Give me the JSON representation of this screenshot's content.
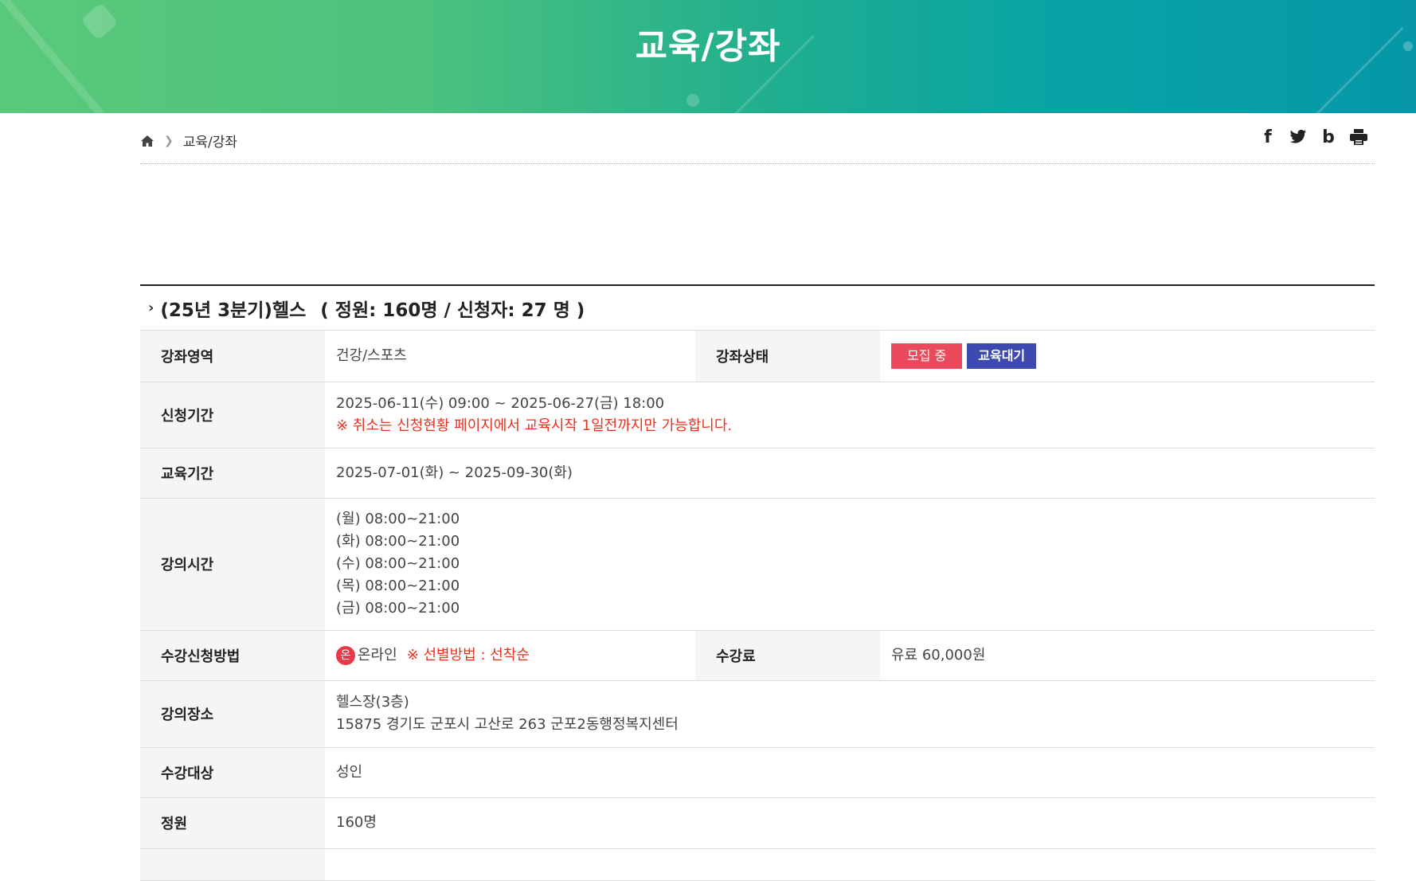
{
  "banner": {
    "title": "교육/강좌"
  },
  "breadcrumb": {
    "current": "교육/강좌"
  },
  "share": {
    "facebook": "f",
    "twitter": "🐦",
    "blog": "b",
    "print": "🖨"
  },
  "course": {
    "name": "(25년 3분기)헬스",
    "capacity_text": "( 정원: 160명 / 신청자: 27 명 )"
  },
  "rows": {
    "area_label": "강좌영역",
    "area_value": "건강/스포츠",
    "status_label": "강좌상태",
    "status_badge1": "모집 중",
    "status_badge2": "교육대기",
    "apply_label": "신청기간",
    "apply_value": "2025-06-11(수) 09:00 ~ 2025-06-27(금) 18:00",
    "apply_note": "※ 취소는 신청현황 페이지에서 교육시작 1일전까지만 가능합니다.",
    "edu_label": "교육기간",
    "edu_value": "2025-07-01(화) ~ 2025-09-30(화)",
    "time_label": "강의시간",
    "times": [
      "(월) 08:00~21:00",
      "(화) 08:00~21:00",
      "(수) 08:00~21:00",
      "(목) 08:00~21:00",
      "(금) 08:00~21:00"
    ],
    "method_label": "수강신청방법",
    "method_icon": "온",
    "method_value": "온라인",
    "method_note": "※ 선별방법 : 선착순",
    "fee_label": "수강료",
    "fee_value": "유료 60,000원",
    "place_label": "강의장소",
    "place_line1": "헬스장(3층)",
    "place_line2": "15875 경기도 군포시 고산로 263 군포2동행정복지센터",
    "target_label": "수강대상",
    "target_value": "성인",
    "cap_label": "정원",
    "cap_value": "160명"
  }
}
